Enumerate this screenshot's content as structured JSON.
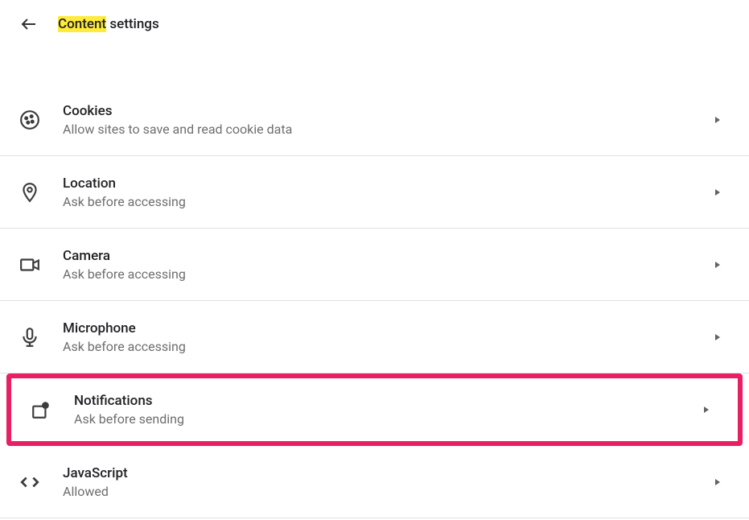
{
  "header": {
    "title_prefix": "Content",
    "title_suffix": " settings"
  },
  "settings": [
    {
      "id": "cookies",
      "title": "Cookies",
      "subtitle": "Allow sites to save and read cookie data",
      "highlighted": false
    },
    {
      "id": "location",
      "title": "Location",
      "subtitle": "Ask before accessing",
      "highlighted": false
    },
    {
      "id": "camera",
      "title": "Camera",
      "subtitle": "Ask before accessing",
      "highlighted": false
    },
    {
      "id": "microphone",
      "title": "Microphone",
      "subtitle": "Ask before accessing",
      "highlighted": false
    },
    {
      "id": "notifications",
      "title": "Notifications",
      "subtitle": "Ask before sending",
      "highlighted": true
    },
    {
      "id": "javascript",
      "title": "JavaScript",
      "subtitle": "Allowed",
      "highlighted": false
    }
  ]
}
